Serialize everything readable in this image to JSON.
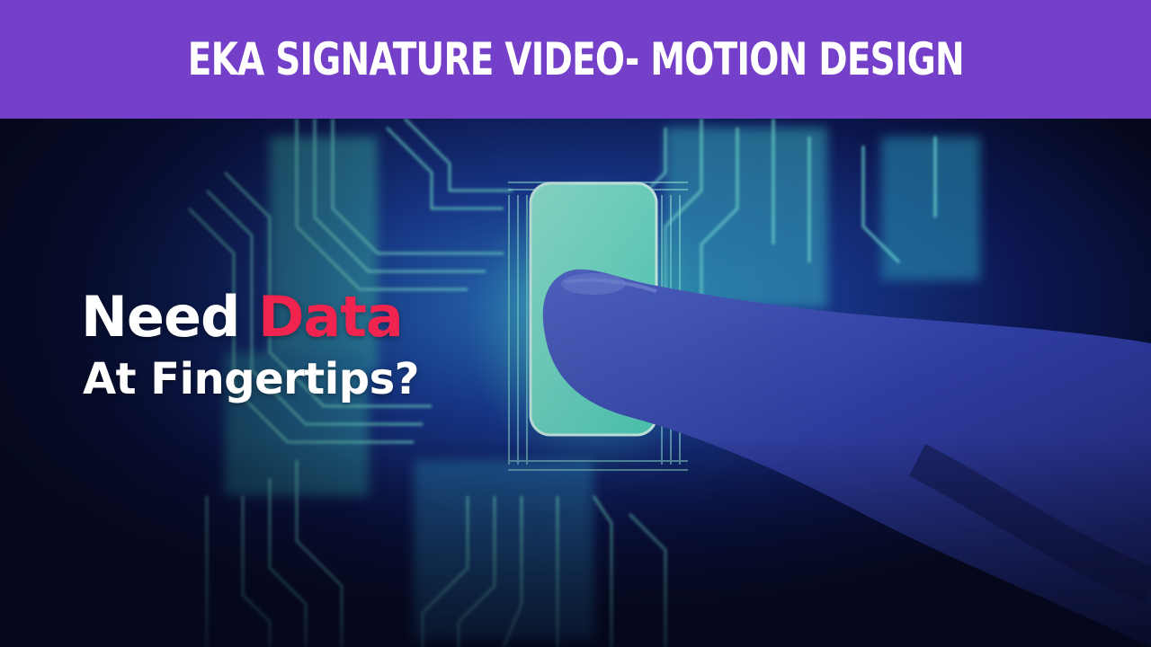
{
  "banner": {
    "title": "EKA SIGNATURE VIDEO- MOTION DESIGN",
    "background_color": "#7440c9",
    "text_color": "#ffffff"
  },
  "headline": {
    "word1": "Need",
    "word2": "Data",
    "line2": "At Fingertips?",
    "accent_color": "#f1244f",
    "text_color": "#ffffff"
  },
  "scene": {
    "description_icons": [
      "circuit-board-graphic",
      "glowing-chip-graphic",
      "finger-graphic"
    ],
    "glow_color": "#5fe8c8",
    "shadow_color": "#05081c"
  }
}
